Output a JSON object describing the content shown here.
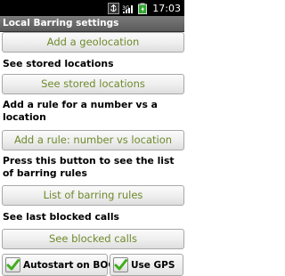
{
  "status_bar": {
    "time": "17:03",
    "icons": [
      "usb-icon",
      "signal-icon",
      "battery-icon"
    ]
  },
  "window": {
    "title": "Local Barring settings"
  },
  "sections": [
    {
      "button_label": "Add a geolocation"
    },
    {
      "description": "See stored locations",
      "button_label": "See stored locations"
    },
    {
      "description": "Add a rule for a number vs a location",
      "button_label": "Add a rule: number vs location"
    },
    {
      "description": "Press this button to see the list of barring rules",
      "button_label": "List of barring rules"
    },
    {
      "description": "See last blocked calls",
      "button_label": "See blocked calls"
    }
  ],
  "checkboxes": [
    {
      "label": "Autostart on BOOT",
      "checked": true
    },
    {
      "label": "Use GPS",
      "checked": true
    }
  ],
  "colors": {
    "button_text": "#6e8a2c",
    "check": "#3fae1a"
  }
}
